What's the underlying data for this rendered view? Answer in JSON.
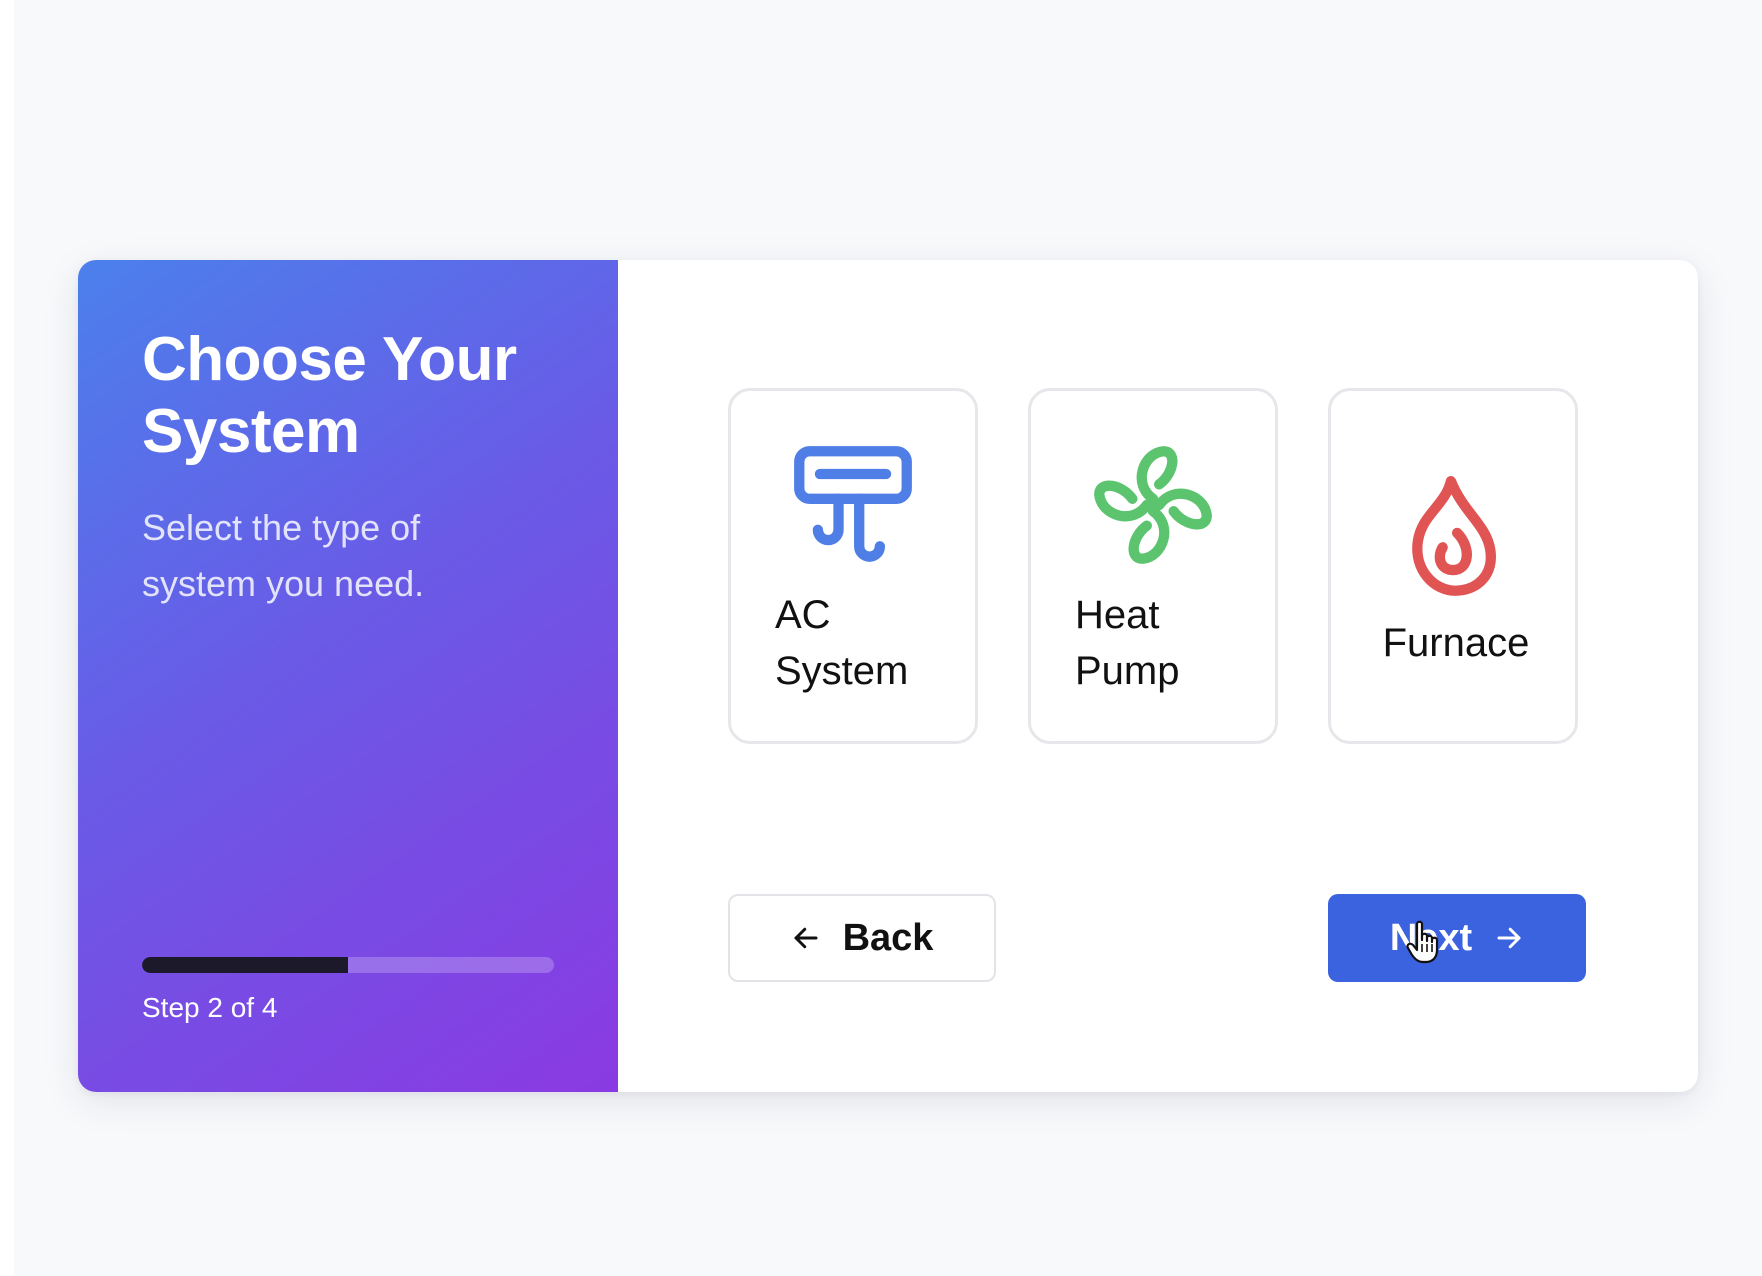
{
  "wizard": {
    "title": "Choose Your System",
    "subtitle": "Select the type of system you need.",
    "progress": {
      "fraction": 0.5,
      "step_label": "Step 2 of 4"
    }
  },
  "options": [
    {
      "label": "AC System",
      "icon": "ac-unit-icon",
      "color": "#4f7fe6"
    },
    {
      "label": "Heat Pump",
      "icon": "fan-icon",
      "color": "#5cc46e"
    },
    {
      "label": "Furnace",
      "icon": "flame-icon",
      "color": "#e05454"
    }
  ],
  "navigation": {
    "back_label": "Back",
    "next_label": "Next",
    "back_icon": "arrow-left-icon",
    "next_icon": "arrow-right-icon"
  },
  "colors": {
    "accent": "#3b63e0",
    "gradient_start": "#4b80ec",
    "gradient_end": "#8a3ae2"
  }
}
